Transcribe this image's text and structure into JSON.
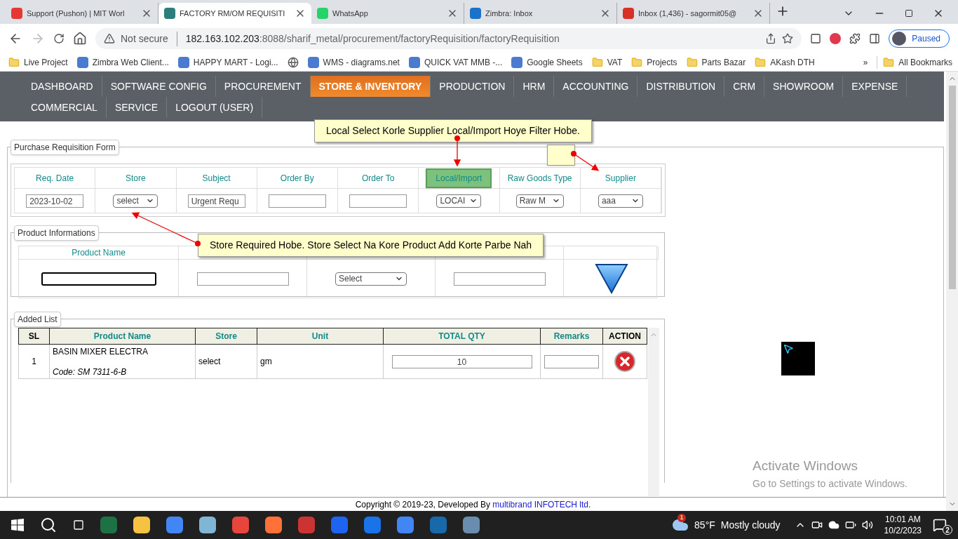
{
  "browser_tabs": [
    {
      "title": "Support (Pushon) | MIT Worl",
      "selected": false
    },
    {
      "title": "FACTORY RM/OM REQUISITI",
      "selected": true
    },
    {
      "title": "WhatsApp",
      "selected": false
    },
    {
      "title": "Zimbra: Inbox",
      "selected": false
    },
    {
      "title": "Inbox (1,436) - sagormit05@",
      "selected": false
    }
  ],
  "address_bar": {
    "security": "Not secure",
    "host": "182.163.102.203",
    "path": ":8088/sharif_metal/procurement/factoryRequisition/factoryRequisition"
  },
  "profile": {
    "label": "Paused"
  },
  "bookmarks": [
    {
      "label": "Live Project",
      "kind": "folder"
    },
    {
      "label": "Zimbra Web Client...",
      "kind": "site"
    },
    {
      "label": "HAPPY MART - Logi...",
      "kind": "site"
    },
    {
      "kind": "globe"
    },
    {
      "label": "WMS - diagrams.net",
      "kind": "site"
    },
    {
      "label": "QUICK VAT MMB -...",
      "kind": "site"
    },
    {
      "label": "Google Sheets",
      "kind": "site"
    },
    {
      "label": "VAT",
      "kind": "folder"
    },
    {
      "label": "Projects",
      "kind": "folder"
    },
    {
      "label": "Parts Bazar",
      "kind": "folder"
    },
    {
      "label": "AKash DTH",
      "kind": "folder"
    }
  ],
  "more_bookmarks": "»",
  "all_bookmarks": "All Bookmarks",
  "nav": [
    {
      "label": "DASHBOARD",
      "selected": false
    },
    {
      "label": "SOFTWARE CONFIG",
      "selected": false
    },
    {
      "label": "PROCUREMENT",
      "selected": false
    },
    {
      "label": "STORE & INVENTORY",
      "selected": true
    },
    {
      "label": "PRODUCTION",
      "selected": false
    },
    {
      "label": "HRM",
      "selected": false
    },
    {
      "label": "ACCOUNTING",
      "selected": false
    },
    {
      "label": "DISTRIBUTION",
      "selected": false
    },
    {
      "label": "CRM",
      "selected": false
    },
    {
      "label": "SHOWROOM",
      "selected": false
    },
    {
      "label": "EXPENSE",
      "selected": false
    },
    {
      "label": "COMMERCIAL",
      "selected": false
    },
    {
      "label": "SERVICE",
      "selected": false
    },
    {
      "label": "LOGOUT (USER)",
      "selected": false
    }
  ],
  "requisition_form": {
    "legend": "Purchase Requisition Form",
    "fields": [
      {
        "label": "Req. Date",
        "kind": "input",
        "value": "2023-10-02",
        "highlighted": false
      },
      {
        "label": "Store",
        "kind": "select",
        "value": "select",
        "highlighted": false
      },
      {
        "label": "Subject",
        "kind": "input",
        "value": "Urgent Requ",
        "highlighted": false
      },
      {
        "label": "Order By",
        "kind": "input",
        "highlighted": false
      },
      {
        "label": "Order To",
        "kind": "input",
        "highlighted": false
      },
      {
        "label": "Local/Import",
        "kind": "select",
        "value": "LOCAI",
        "highlighted": true
      },
      {
        "label": "Raw Goods Type",
        "kind": "select",
        "value": "Raw M",
        "highlighted": false
      },
      {
        "label": "Supplier",
        "kind": "select",
        "value": "aaa",
        "highlighted": false
      }
    ]
  },
  "product_info": {
    "legend": "Product Informations",
    "columns": [
      "Product Name"
    ],
    "unit_select": "Select"
  },
  "added_list": {
    "legend": "Added List",
    "columns": [
      "SL",
      "Product Name",
      "Store",
      "Unit",
      "TOTAL QTY",
      "Remarks",
      "ACTION"
    ],
    "rows": [
      {
        "sl": "1",
        "product": "BASIN MIXER ELECTRA",
        "code": "Code: SM 7311-6-B",
        "store": "select",
        "unit": "gm",
        "total_qty": "10"
      }
    ]
  },
  "callouts": [
    {
      "text": "Local Select Korle Supplier Local/Import Hoye Filter Hobe."
    },
    {
      "text": "Store Required Hobe. Store Select Na Kore Product Add Korte Parbe Nah"
    }
  ],
  "footer": {
    "text": "Copyright © 2019-23, Developed By ",
    "link": "multibrand INFOTECH ltd."
  },
  "activation": {
    "title": "Activate Windows",
    "subtitle": "Go to Settings to activate Windows."
  },
  "taskbar": {
    "weather": {
      "temp": "85°F",
      "text": "Mostly cloudy",
      "badge": "1"
    },
    "time": "10:01 AM",
    "date": "10/2/2023",
    "notifications": "2"
  }
}
